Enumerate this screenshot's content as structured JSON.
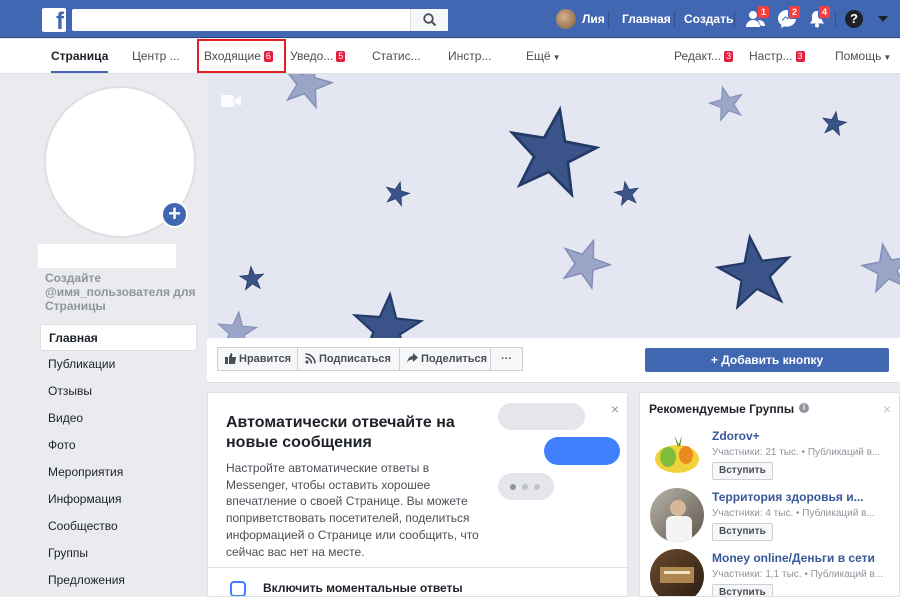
{
  "topbar": {
    "logo": "f",
    "search_placeholder": "",
    "user_name": "Лия",
    "home_label": "Главная",
    "create_label": "Создать",
    "friends_badge": "1",
    "messages_badge": "2",
    "notifications_badge": "4",
    "help_glyph": "?"
  },
  "page_nav": {
    "items": [
      {
        "label": "Страница"
      },
      {
        "label": "Центр ..."
      },
      {
        "label": "Входящие",
        "badge": "6"
      },
      {
        "label": "Уведо...",
        "badge": "5"
      },
      {
        "label": "Статис..."
      },
      {
        "label": "Инстр..."
      },
      {
        "label": "Ещё"
      },
      {
        "label": "Редакт...",
        "badge": "3"
      },
      {
        "label": "Настр...",
        "badge": "3"
      },
      {
        "label": "Помощь"
      }
    ]
  },
  "left": {
    "create_username": "Создайте @имя_пользователя для Страницы",
    "menu": [
      "Главная",
      "Публикации",
      "Отзывы",
      "Видео",
      "Фото",
      "Мероприятия",
      "Информация",
      "Сообщество",
      "Группы",
      "Предложения"
    ]
  },
  "actions": {
    "like": "Нравится",
    "follow": "Подписаться",
    "share": "Поделиться",
    "more": "···",
    "add_button": "Добавить кнопку"
  },
  "auto_reply": {
    "title": "Автоматически отвечайте на новые сообщения",
    "body": "Настройте автоматические ответы в Messenger, чтобы оставить хорошее впечатление о своей Странице. Вы можете поприветствовать посетителей, поделиться информацией о Странице или сообщить, что сейчас вас нет на месте.",
    "footer": "Включить моментальные ответы",
    "close": "×"
  },
  "groups": {
    "title": "Рекомендуемые Группы",
    "close": "×",
    "items": [
      {
        "name": "Zdorov+",
        "meta": "Участники: 21 тыс. • Публикаций в...",
        "join": "Вступить"
      },
      {
        "name": "Территория здоровья и...",
        "meta": "Участники: 4 тыс. • Публикаций в...",
        "join": "Вступить"
      },
      {
        "name": "Money online/Деньги в сети",
        "meta": "Участники: 1,1 тыс. • Публикаций в...",
        "join": "Вступить"
      }
    ]
  },
  "colors": {
    "brand": "#4267b2",
    "badge": "#fa3e3e",
    "highlight_box": "#e02020",
    "star": "#3a5489"
  }
}
